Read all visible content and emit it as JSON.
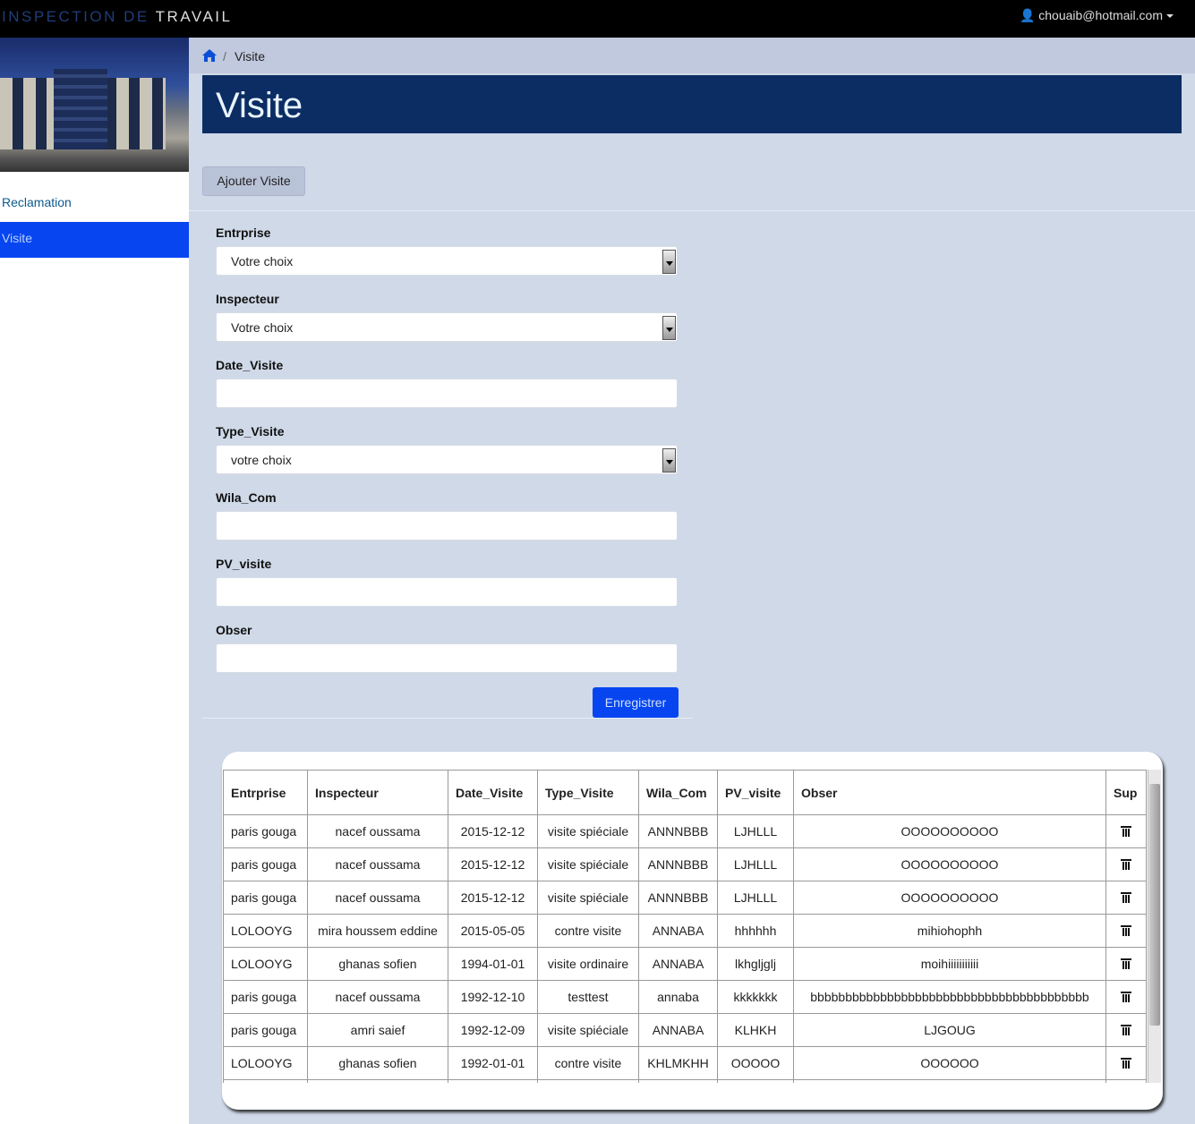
{
  "header": {
    "brand_part1": "INSPECTION DE ",
    "brand_part2": "TRAVAIL",
    "user": "chouaib@hotmail.com"
  },
  "sidebar": {
    "items": [
      {
        "label": "Reclamation"
      },
      {
        "label": "Visite",
        "active": true
      }
    ]
  },
  "breadcrumb": {
    "separator": "/",
    "current": "Visite"
  },
  "page_title": "Visite",
  "add_button": "Ajouter Visite",
  "form": {
    "entreprise": {
      "label": "Entrprise",
      "value": "Votre choix"
    },
    "inspecteur": {
      "label": "Inspecteur",
      "value": "Votre choix"
    },
    "date": {
      "label": "Date_Visite",
      "value": ""
    },
    "type": {
      "label": "Type_Visite",
      "value": "votre choix"
    },
    "wila": {
      "label": "Wila_Com",
      "value": ""
    },
    "pv": {
      "label": "PV_visite",
      "value": ""
    },
    "obser": {
      "label": "Obser",
      "value": ""
    },
    "submit": "Enregistrer"
  },
  "table": {
    "headers": [
      "Entrprise",
      "Inspecteur",
      "Date_Visite",
      "Type_Visite",
      "Wila_Com",
      "PV_visite",
      "Obser",
      "Sup"
    ],
    "rows": [
      [
        "paris gouga",
        "nacef oussama",
        "2015-12-12",
        "visite spiéciale",
        "ANNNBBB",
        "LJHLLL",
        "OOOOOOOOOO"
      ],
      [
        "paris gouga",
        "nacef oussama",
        "2015-12-12",
        "visite spiéciale",
        "ANNNBBB",
        "LJHLLL",
        "OOOOOOOOOO"
      ],
      [
        "paris gouga",
        "nacef oussama",
        "2015-12-12",
        "visite spiéciale",
        "ANNNBBB",
        "LJHLLL",
        "OOOOOOOOOO"
      ],
      [
        "LOLOOYG",
        "mira houssem eddine",
        "2015-05-05",
        "contre visite",
        "ANNABA",
        "hhhhhh",
        "mihiohophh"
      ],
      [
        "LOLOOYG",
        "ghanas sofien",
        "1994-01-01",
        "visite ordinaire",
        "ANNABA",
        "lkhgljglj",
        "moihiiiiiiiiiii"
      ],
      [
        "paris gouga",
        "nacef oussama",
        "1992-12-10",
        "testtest",
        "annaba",
        "kkkkkkk",
        "bbbbbbbbbbbbbbbbbbbbbbbbbbbbbbbbbbbbbbbb"
      ],
      [
        "paris gouga",
        "amri saief",
        "1992-12-09",
        "visite spiéciale",
        "ANNABA",
        "KLHKH",
        "LJGOUG"
      ],
      [
        "LOLOOYG",
        "ghanas sofien",
        "1992-01-01",
        "contre visite",
        "KHLMKHH",
        "OOOOO",
        "OOOOOO"
      ],
      [
        "",
        "",
        "",
        "",
        "",
        "",
        ""
      ]
    ]
  }
}
